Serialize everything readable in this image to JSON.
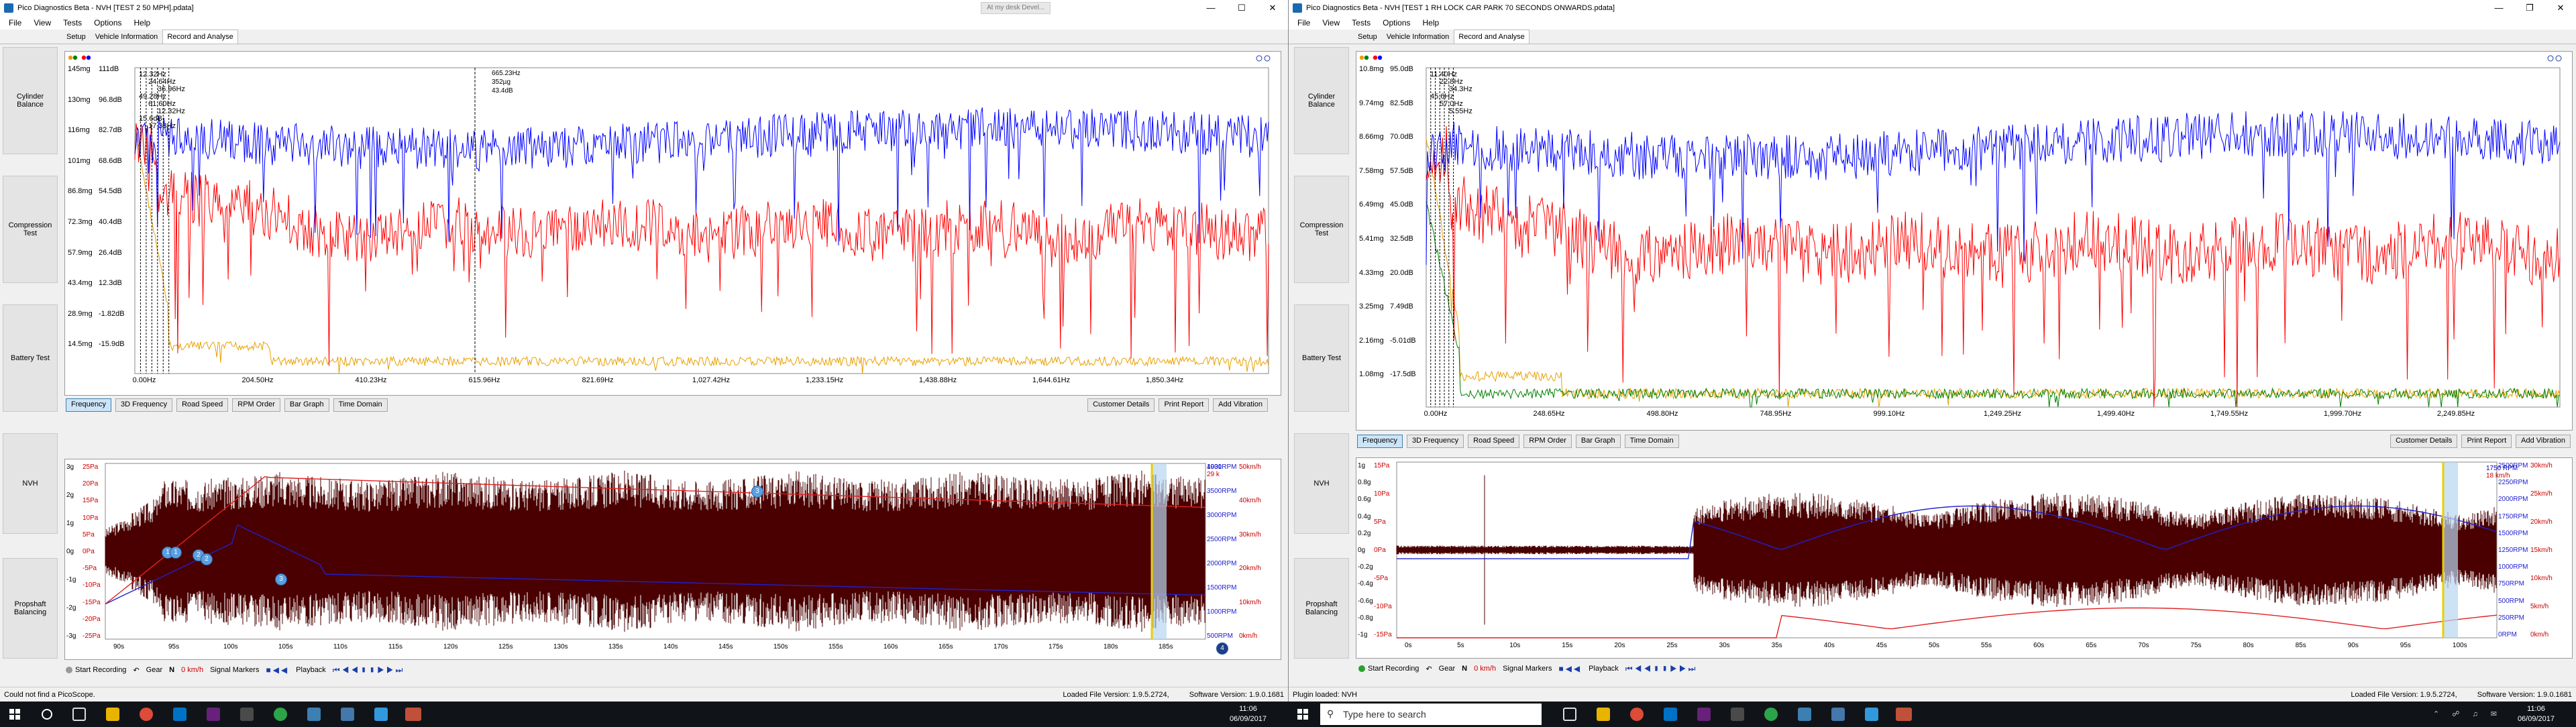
{
  "left": {
    "title": "Pico Diagnostics Beta - NVH [TEST 2 50 MPH].pdata]",
    "ghost_tab": "At my desk Devel...",
    "menu": [
      "File",
      "View",
      "Tests",
      "Options",
      "Help"
    ],
    "tabs": [
      "Setup",
      "Vehicle Information",
      "Record and Analyse"
    ],
    "sidebar": [
      "Cylinder Balance",
      "Compression Test",
      "Battery Test",
      "NVH",
      "Propshaft Balancing"
    ],
    "freq_y": [
      "145mg",
      "130mg",
      "116mg",
      "101mg",
      "86.8mg",
      "72.3mg",
      "57.9mg",
      "43.4mg",
      "28.9mg",
      "14.5mg"
    ],
    "freq_y_db": [
      "111dB",
      "96.8dB",
      "82.7dB",
      "68.6dB",
      "54.5dB",
      "40.4dB",
      "26.4dB",
      "12.3dB",
      "-1.82dB",
      "-15.9dB"
    ],
    "freq_x": [
      "0.00Hz",
      "204.50Hz",
      "410.23Hz",
      "615.96Hz",
      "821.69Hz",
      "1,027.42Hz",
      "1,233.15Hz",
      "1,438.88Hz",
      "1,644.61Hz",
      "1,850.34Hz"
    ],
    "peak_labels": [
      "12.32Hz",
      "24.64Hz",
      "36.96Hz",
      "49.28Hz",
      "61.60Hz",
      "12.32Hz",
      "15.6dB",
      "17.38Hz"
    ],
    "cursor_label": [
      "665.23Hz",
      "352µg",
      "43.4dB"
    ],
    "toolbar": [
      "Frequency",
      "3D Frequency",
      "Road Speed",
      "RPM Order",
      "Bar Graph",
      "Time Domain"
    ],
    "toolbar_right": [
      "Customer Details",
      "Print Report",
      "Add Vibration"
    ],
    "time_y": [
      "3g",
      "2g",
      "1g",
      "0g",
      "-1g",
      "-2g",
      "-3g"
    ],
    "time_y_pa": [
      "25Pa",
      "20Pa",
      "15Pa",
      "10Pa",
      "5Pa",
      "0Pa",
      "-5Pa",
      "-10Pa",
      "-15Pa",
      "-20Pa",
      "-25Pa"
    ],
    "rpm_labels": [
      "4000RPM",
      "3500RPM",
      "3000RPM",
      "2500RPM",
      "2000RPM",
      "1500RPM",
      "1000RPM",
      "500RPM"
    ],
    "speed_labels": [
      "50km/h",
      "40km/h",
      "30km/h",
      "20km/h",
      "10km/h",
      "0km/h"
    ],
    "time_x": [
      "90s",
      "95s",
      "100s",
      "105s",
      "110s",
      "115s",
      "120s",
      "125s",
      "130s",
      "135s",
      "140s",
      "145s",
      "150s",
      "155s",
      "160s",
      "165s",
      "170s",
      "175s",
      "180s",
      "185s"
    ],
    "cursor_readout": [
      "1931",
      "29 k"
    ],
    "markers": [
      "1",
      "1",
      "2",
      "2",
      "3",
      "3",
      "4"
    ],
    "playbar": {
      "record": "Start Recording",
      "gear": "Gear",
      "gear_val": "N",
      "speed": "0 km/h",
      "signal": "Signal Markers",
      "playback": "Playback"
    },
    "status_left": "Could not find a PicoScope.",
    "status_file": "Loaded File Version: 1.9.5.2724,",
    "status_sw": "Software Version: 1.9.0.1681"
  },
  "right": {
    "title": "Pico Diagnostics Beta - NVH [TEST 1 RH LOCK CAR PARK 70 SECONDS ONWARDS.pdata]",
    "menu": [
      "File",
      "View",
      "Tests",
      "Options",
      "Help"
    ],
    "tabs": [
      "Setup",
      "Vehicle Information",
      "Record and Analyse"
    ],
    "sidebar": [
      "Cylinder Balance",
      "Compression Test",
      "Battery Test",
      "NVH",
      "Propshaft Balancing"
    ],
    "freq_y": [
      "10.8mg",
      "9.74mg",
      "8.66mg",
      "7.58mg",
      "6.49mg",
      "5.41mg",
      "4.33mg",
      "3.25mg",
      "2.16mg",
      "1.08mg"
    ],
    "freq_y_db": [
      "95.0dB",
      "82.5dB",
      "70.0dB",
      "57.5dB",
      "45.0dB",
      "32.5dB",
      "20.0dB",
      "7.49dB",
      "-5.01dB",
      "-17.5dB"
    ],
    "freq_x": [
      "0.00Hz",
      "248.65Hz",
      "498.80Hz",
      "748.95Hz",
      "999.10Hz",
      "1,249.25Hz",
      "1,499.40Hz",
      "1,749.55Hz",
      "1,999.70Hz",
      "2,249.85Hz"
    ],
    "peak_labels": [
      "11.40Hz",
      "22.8Hz",
      "34.3Hz",
      "45.6Hz",
      "57.0Hz",
      "5.55Hz"
    ],
    "toolbar": [
      "Frequency",
      "3D Frequency",
      "Road Speed",
      "RPM Order",
      "Bar Graph",
      "Time Domain"
    ],
    "toolbar_right": [
      "Customer Details",
      "Print Report",
      "Add Vibration"
    ],
    "time_y": [
      "1g",
      "0.8g",
      "0.6g",
      "0.4g",
      "0.2g",
      "0g",
      "-0.2g",
      "-0.4g",
      "-0.6g",
      "-0.8g",
      "-1g"
    ],
    "time_y_pa": [
      "15Pa",
      "10Pa",
      "5Pa",
      "0Pa",
      "-5Pa",
      "-10Pa",
      "-15Pa"
    ],
    "rpm_labels": [
      "2500RPM",
      "2250RPM",
      "2000RPM",
      "1750RPM",
      "1500RPM",
      "1250RPM",
      "1000RPM",
      "750RPM",
      "500RPM",
      "250RPM",
      "0RPM"
    ],
    "speed_labels": [
      "30km/h",
      "25km/h",
      "20km/h",
      "15km/h",
      "10km/h",
      "5km/h",
      "0km/h"
    ],
    "time_x": [
      "0s",
      "5s",
      "10s",
      "15s",
      "20s",
      "25s",
      "30s",
      "35s",
      "40s",
      "45s",
      "50s",
      "55s",
      "60s",
      "65s",
      "70s",
      "75s",
      "80s",
      "85s",
      "90s",
      "95s",
      "100s"
    ],
    "cursor_readout": [
      "1750 RPM",
      "18 km/h"
    ],
    "playbar": {
      "record": "Start Recording",
      "gear": "Gear",
      "gear_val": "N",
      "speed": "0 km/h",
      "signal": "Signal Markers",
      "playback": "Playback"
    },
    "status_left": "Plugin loaded: NVH",
    "status_file": "Loaded File Version: 1.9.5.2724,",
    "status_sw": "Software Version: 1.9.0.1681"
  },
  "taskbar": {
    "search_placeholder": "Type here to search",
    "time_left": "11:06",
    "date_left": "06/09/2017",
    "time_right": "11:06",
    "date_right": "06/09/2017"
  },
  "colors": {
    "x_axis": "#0000ff",
    "y_axis": "#ff0000",
    "z_axis": "#e8a000",
    "mic": "#008000",
    "time_trace": "#4a0000"
  }
}
